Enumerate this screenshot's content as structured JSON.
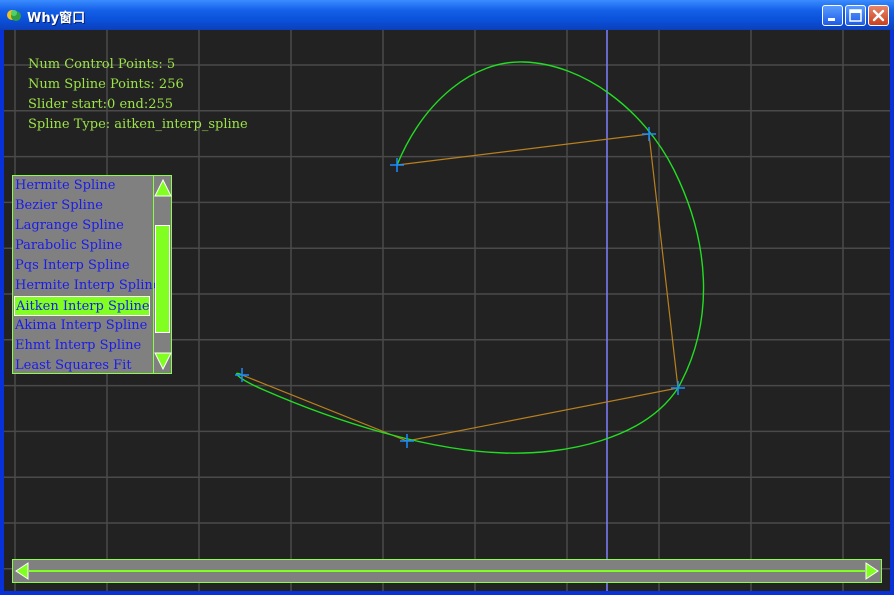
{
  "window": {
    "title": "Why窗口",
    "icons": {
      "app": "app-logo-icon",
      "minimize": "minimize-icon",
      "maximize": "maximize-icon",
      "close": "close-icon"
    }
  },
  "info": {
    "num_control_points": "Num Control Points: 5",
    "num_spline_points": "Num Spline Points: 256",
    "slider": "Slider start:0 end:255",
    "spline_type": "Spline Type: aitken_interp_spline"
  },
  "spline_list": {
    "items": [
      "Hermite Spline",
      "Bezier Spline",
      "Lagrange Spline",
      "Parabolic Spline",
      "Pqs Interp Spline",
      "Hermite Interp Spline",
      "Aitken Interp Spline",
      "Akima Interp Spline",
      "Ehmt Interp Spline",
      "Least Squares Fit"
    ],
    "selected_index": 6,
    "icons": {
      "up": "scroll-up-arrow-icon",
      "down": "scroll-down-arrow-icon"
    }
  },
  "slider": {
    "start": 0,
    "end": 255,
    "icons": {
      "left": "scroll-left-arrow-icon",
      "right": "scroll-right-arrow-icon"
    }
  },
  "colors": {
    "background": "#222222",
    "grid": "#4a4a4a",
    "axis": "#8080ff",
    "spline": "#22dd22",
    "control_polygon": "#b8801e",
    "control_point": "#1a8cff",
    "text": "#9de34a",
    "list_bg": "#808080",
    "list_text": "#1a1aee",
    "accent": "#80ff20"
  }
}
